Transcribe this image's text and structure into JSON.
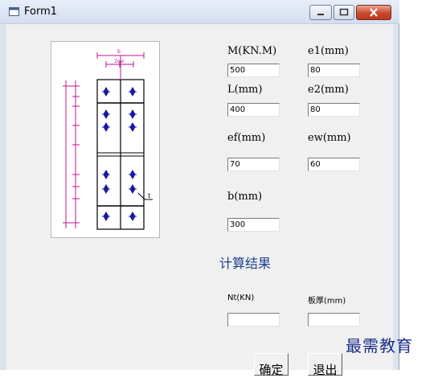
{
  "window": {
    "title": "Form1"
  },
  "fields": [
    {
      "label": "M(KN.M)",
      "value": "500"
    },
    {
      "label": "e1(mm)",
      "value": "80"
    },
    {
      "label": "L(mm)",
      "value": "400"
    },
    {
      "label": "e2(mm)",
      "value": "80"
    },
    {
      "label": "ef(mm)",
      "value": "70"
    },
    {
      "label": "ew(mm)",
      "value": "60"
    },
    {
      "label": "b(mm)",
      "value": "300"
    }
  ],
  "results": {
    "title": "计算结果",
    "nt_label": "Nt(KN)",
    "nt_value": "",
    "thickness_label": "板厚(mm)",
    "thickness_value": ""
  },
  "buttons": {
    "ok": "确定",
    "exit": "退出"
  },
  "diagram": {
    "top_label": "b",
    "sub_label": "2ew",
    "side_label": "t"
  },
  "watermark": "最需教育",
  "colors": {
    "accent": "#1f3f8f",
    "close_button": "#c94a2e",
    "diagram_dims": "#c0158a",
    "bolt": "#1a1aa0"
  }
}
